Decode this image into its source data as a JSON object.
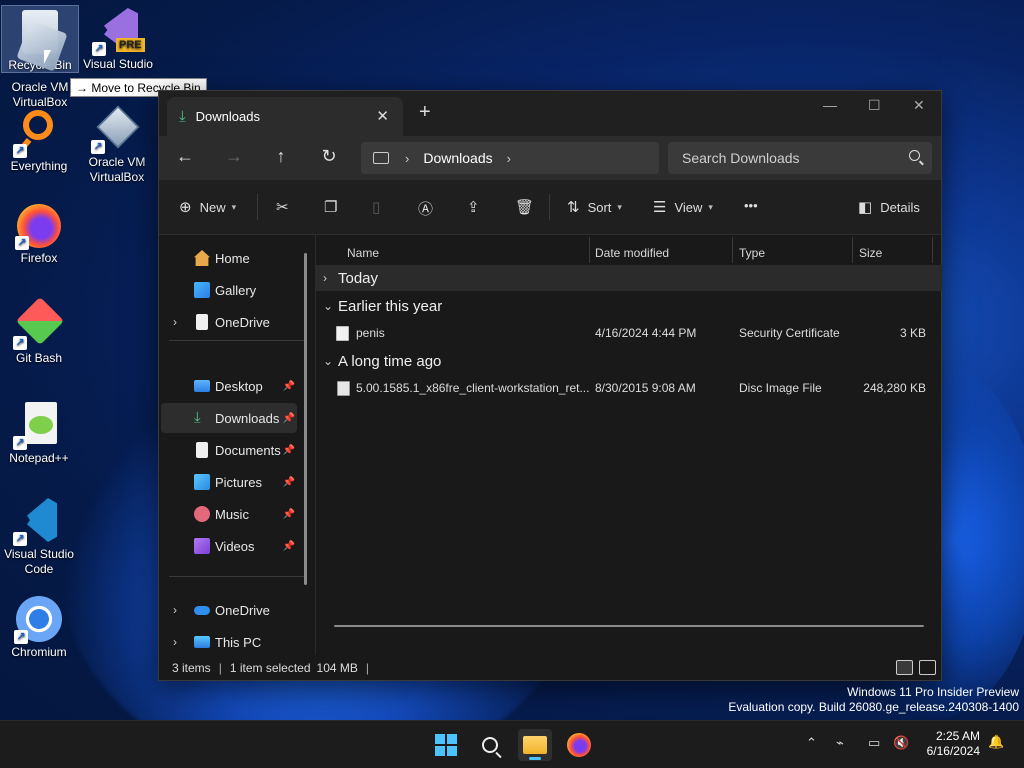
{
  "desktop": {
    "icons": [
      {
        "label": "Recycle Bin"
      },
      {
        "label": "Visual Studio 2022 Preview"
      },
      {
        "label": "Oracle VM VirtualBox"
      },
      {
        "label": "Everything"
      },
      {
        "label": "Oracle VM VirtualBox"
      },
      {
        "label": "Firefox"
      },
      {
        "label": "Git Bash"
      },
      {
        "label": "Notepad++"
      },
      {
        "label": "Visual Studio Code"
      },
      {
        "label": "Chromium"
      }
    ],
    "drag_tooltip": "Move to Recycle Bin",
    "vs_badge": "PRE"
  },
  "explorer": {
    "tab_title": "Downloads",
    "breadcrumb": [
      "Downloads"
    ],
    "search_placeholder": "Search Downloads",
    "commands": {
      "new": "New",
      "sort": "Sort",
      "view": "View",
      "more": "•••",
      "details": "Details"
    },
    "sidebar": {
      "quick": [
        {
          "label": "Home"
        },
        {
          "label": "Gallery"
        },
        {
          "label": "OneDrive"
        }
      ],
      "pinned": [
        {
          "label": "Desktop"
        },
        {
          "label": "Downloads"
        },
        {
          "label": "Documents"
        },
        {
          "label": "Pictures"
        },
        {
          "label": "Music"
        },
        {
          "label": "Videos"
        }
      ],
      "bottom": [
        {
          "label": "OneDrive"
        },
        {
          "label": "This PC"
        }
      ]
    },
    "columns": {
      "name": "Name",
      "date": "Date modified",
      "type": "Type",
      "size": "Size"
    },
    "groups": [
      {
        "label": "Today"
      },
      {
        "label": "Earlier this year"
      },
      {
        "label": "A long time ago"
      }
    ],
    "files": [
      {
        "name": "penis",
        "date": "4/16/2024 4:44 PM",
        "type": "Security Certificate",
        "size": "3 KB"
      },
      {
        "name": "5.00.1585.1_x86fre_client-workstation_ret...",
        "date": "8/30/2015 9:08 AM",
        "type": "Disc Image File",
        "size": "248,280 KB"
      }
    ],
    "status": {
      "items": "3 items",
      "selected": "1 item selected",
      "size": "104 MB"
    }
  },
  "watermark": {
    "line1": "Windows 11 Pro Insider Preview",
    "line2": "Evaluation copy. Build 26080.ge_release.240308-1400"
  },
  "clock": {
    "time": "2:25 AM",
    "date": "6/16/2024"
  },
  "colors": {
    "accent": "#4cc2ff",
    "folder_green": "#4cc38a"
  }
}
